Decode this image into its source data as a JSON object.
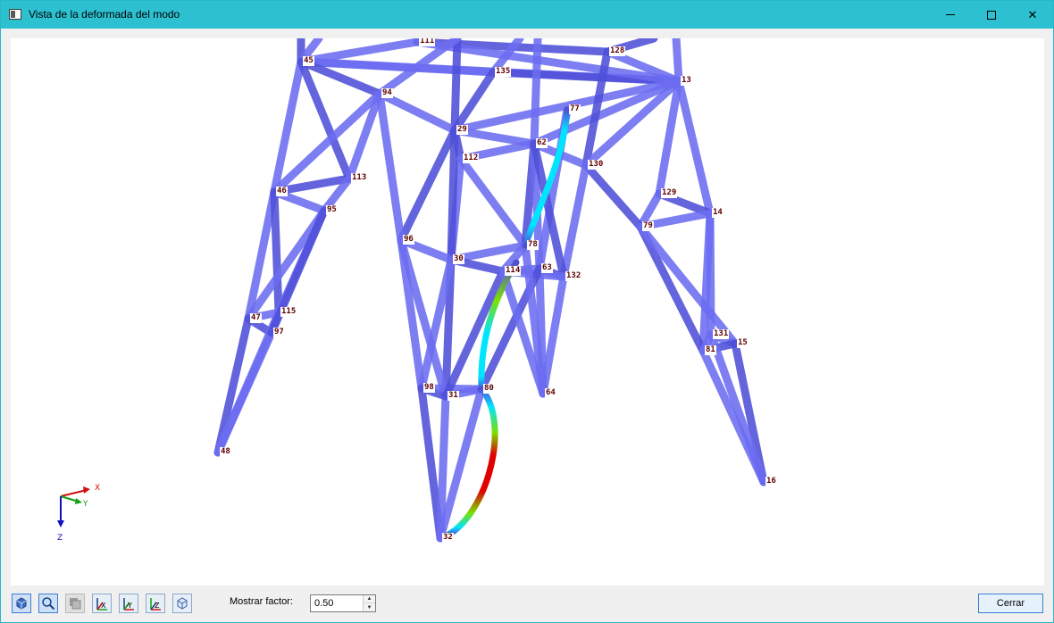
{
  "window": {
    "title": "Vista de la deformada del modo",
    "minimize_glyph": "",
    "maximize_glyph": "",
    "close_glyph": "✕"
  },
  "viewport": {
    "node_labels": [
      "45",
      "111",
      "128",
      "135",
      "13",
      "94",
      "77",
      "29",
      "62",
      "112",
      "130",
      "46",
      "113",
      "129",
      "14",
      "95",
      "79",
      "96",
      "78",
      "30",
      "63",
      "114",
      "132",
      "47",
      "115",
      "97",
      "131",
      "15",
      "81",
      "98",
      "31",
      "80",
      "64",
      "48",
      "16",
      "32"
    ],
    "axes": {
      "x_label": "X",
      "y_label": "Y",
      "z_label": "Z"
    },
    "colors": {
      "member": "#6b6cf0",
      "member_dark": "#4f50d8",
      "deformed_low": "#00e5ff",
      "deformed_mid": "#7be000",
      "deformed_high": "#e00000",
      "node_label_text": "#600000",
      "axis_x": "#d01010",
      "axis_y": "#10a010",
      "axis_z": "#1010c0"
    }
  },
  "toolbar": {
    "buttons": [
      {
        "name": "view-3d-button",
        "icon": "cube-view-icon"
      },
      {
        "name": "zoom-button",
        "icon": "magnifier-icon"
      },
      {
        "name": "render-button",
        "icon": "render-icon"
      },
      {
        "name": "view-x-button",
        "icon": "axis-x-view-icon",
        "label": "X"
      },
      {
        "name": "view-neg-y-button",
        "icon": "axis-neg-y-view-icon",
        "label": "-Y"
      },
      {
        "name": "view-z-button",
        "icon": "axis-z-view-icon",
        "label": "Z"
      },
      {
        "name": "iso-view-button",
        "icon": "iso-box-icon"
      }
    ],
    "factor_label": "Mostrar factor:",
    "factor_value": "0.50",
    "close_label": "Cerrar"
  }
}
